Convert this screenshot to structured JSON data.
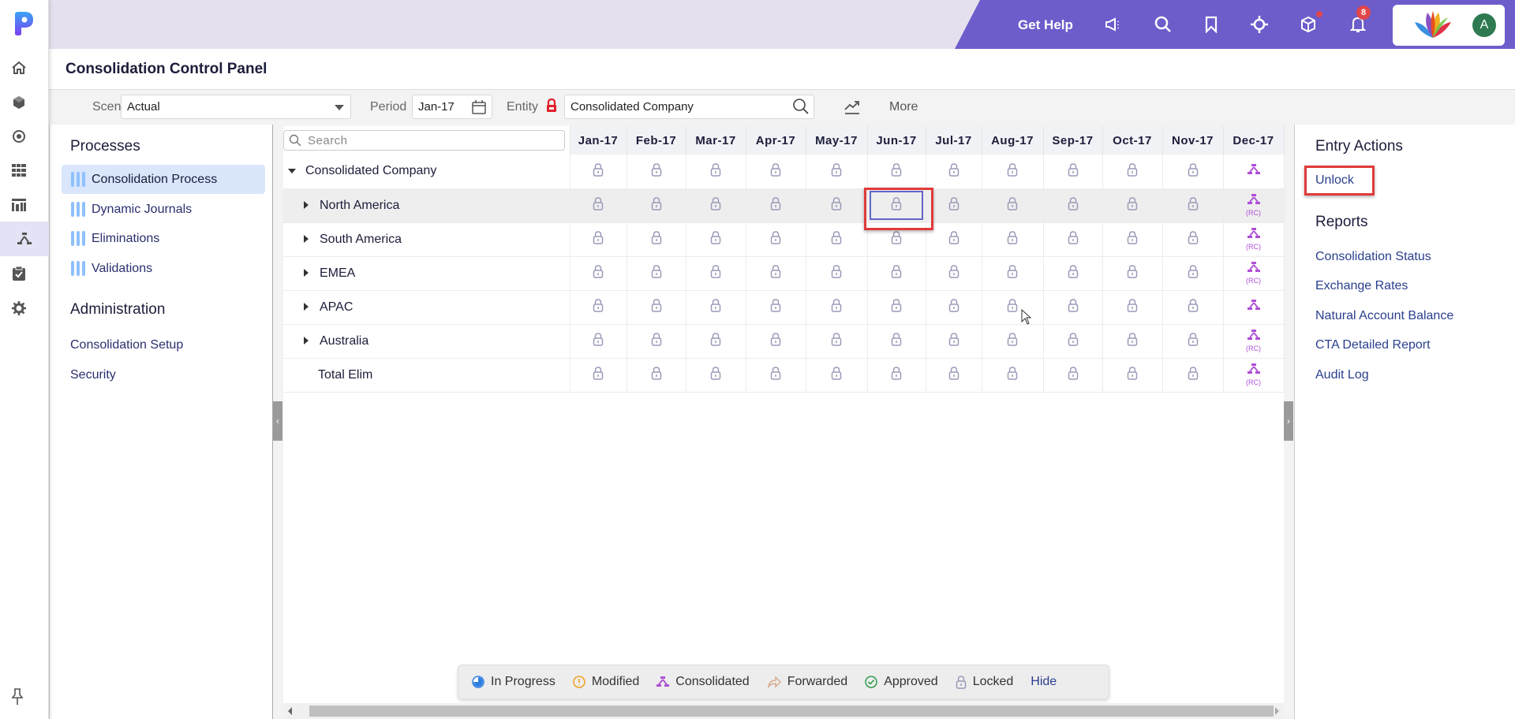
{
  "header": {
    "get_help": "Get Help",
    "icons": [
      "megaphone-icon",
      "search-icon",
      "bookmark-icon",
      "target-icon",
      "cube-icon",
      "bell-icon"
    ],
    "notification_count": "8",
    "user_initial": "A",
    "colors": {
      "header_bg": "#6c5dcb",
      "accent": "#e0474c"
    }
  },
  "rail": {
    "icons": [
      "home-icon",
      "cube-icon",
      "target-icon",
      "grid-icon",
      "report-icon",
      "hierarchy-icon",
      "clipboard-check-icon",
      "gear-icon"
    ],
    "active_index": 5
  },
  "page": {
    "title": "Consolidation Control Panel"
  },
  "toolbar": {
    "scenario_label": "Scenario",
    "scenario_value": "Actual",
    "period_label": "Period",
    "period_value": "Jan-17",
    "entity_label": "Entity",
    "entity_value": "Consolidated Company",
    "more_label": "More"
  },
  "left_panel": {
    "processes_heading": "Processes",
    "processes": [
      {
        "label": "Consolidation Process",
        "active": true
      },
      {
        "label": "Dynamic Journals",
        "active": false
      },
      {
        "label": "Eliminations",
        "active": false
      },
      {
        "label": "Validations",
        "active": false
      }
    ],
    "admin_heading": "Administration",
    "admin_links": [
      "Consolidation Setup",
      "Security"
    ]
  },
  "grid": {
    "search_placeholder": "Search",
    "months": [
      "Jan-17",
      "Feb-17",
      "Mar-17",
      "Apr-17",
      "May-17",
      "Jun-17",
      "Jul-17",
      "Aug-17",
      "Sep-17",
      "Oct-17",
      "Nov-17",
      "Dec-17"
    ],
    "rows": [
      {
        "name": "Consolidated Company",
        "level": 0,
        "expander": "expanded",
        "statuses": [
          "locked",
          "locked",
          "locked",
          "locked",
          "locked",
          "locked",
          "locked",
          "locked",
          "locked",
          "locked",
          "locked",
          "consolidated"
        ],
        "rc": [
          false,
          false,
          false,
          false,
          false,
          false,
          false,
          false,
          false,
          false,
          false,
          false
        ]
      },
      {
        "name": "North America",
        "level": 1,
        "expander": "collapsed",
        "selected": true,
        "statuses": [
          "locked",
          "locked",
          "locked",
          "locked",
          "locked",
          "locked",
          "locked",
          "locked",
          "locked",
          "locked",
          "locked",
          "consolidated"
        ],
        "rc": [
          false,
          false,
          false,
          false,
          false,
          false,
          false,
          false,
          false,
          false,
          false,
          true
        ]
      },
      {
        "name": "South America",
        "level": 1,
        "expander": "collapsed",
        "statuses": [
          "locked",
          "locked",
          "locked",
          "locked",
          "locked",
          "locked",
          "locked",
          "locked",
          "locked",
          "locked",
          "locked",
          "consolidated"
        ],
        "rc": [
          false,
          false,
          false,
          false,
          false,
          false,
          false,
          false,
          false,
          false,
          false,
          true
        ]
      },
      {
        "name": "EMEA",
        "level": 1,
        "expander": "collapsed",
        "statuses": [
          "locked",
          "locked",
          "locked",
          "locked",
          "locked",
          "locked",
          "locked",
          "locked",
          "locked",
          "locked",
          "locked",
          "consolidated"
        ],
        "rc": [
          false,
          false,
          false,
          false,
          false,
          false,
          false,
          false,
          false,
          false,
          false,
          true
        ]
      },
      {
        "name": "APAC",
        "level": 1,
        "expander": "collapsed",
        "statuses": [
          "locked",
          "locked",
          "locked",
          "locked",
          "locked",
          "locked",
          "locked",
          "locked",
          "locked",
          "locked",
          "locked",
          "consolidated"
        ],
        "rc": [
          false,
          false,
          false,
          false,
          false,
          false,
          false,
          false,
          false,
          false,
          false,
          false
        ]
      },
      {
        "name": "Australia",
        "level": 1,
        "expander": "collapsed",
        "statuses": [
          "locked",
          "locked",
          "locked",
          "locked",
          "locked",
          "locked",
          "locked",
          "locked",
          "locked",
          "locked",
          "locked",
          "consolidated"
        ],
        "rc": [
          false,
          false,
          false,
          false,
          false,
          false,
          false,
          false,
          false,
          false,
          false,
          true
        ]
      },
      {
        "name": "Total Elim",
        "level": 1,
        "expander": "none",
        "statuses": [
          "locked",
          "locked",
          "locked",
          "locked",
          "locked",
          "locked",
          "locked",
          "locked",
          "locked",
          "locked",
          "locked",
          "consolidated"
        ],
        "rc": [
          false,
          false,
          false,
          false,
          false,
          false,
          false,
          false,
          false,
          false,
          false,
          true
        ]
      }
    ],
    "rc_label": "(RC)",
    "selected_cell": {
      "row": "North America",
      "month": "Jun-17"
    }
  },
  "legend": {
    "items": [
      {
        "icon": "in-progress-icon",
        "label": "In Progress",
        "color": "#2f7fe0"
      },
      {
        "icon": "modified-icon",
        "label": "Modified",
        "color": "#f0a020"
      },
      {
        "icon": "consolidated-icon",
        "label": "Consolidated",
        "color": "#b04fd6"
      },
      {
        "icon": "forwarded-icon",
        "label": "Forwarded",
        "color": "#d9a98f"
      },
      {
        "icon": "approved-icon",
        "label": "Approved",
        "color": "#2e9a4c"
      },
      {
        "icon": "locked-icon",
        "label": "Locked",
        "color": "#9a9ab8"
      }
    ],
    "hide_label": "Hide"
  },
  "right_panel": {
    "entry_actions_heading": "Entry Actions",
    "entry_actions": [
      "Unlock"
    ],
    "reports_heading": "Reports",
    "reports": [
      "Consolidation Status",
      "Exchange Rates",
      "Natural Account Balance",
      "CTA Detailed Report",
      "Audit Log"
    ]
  }
}
